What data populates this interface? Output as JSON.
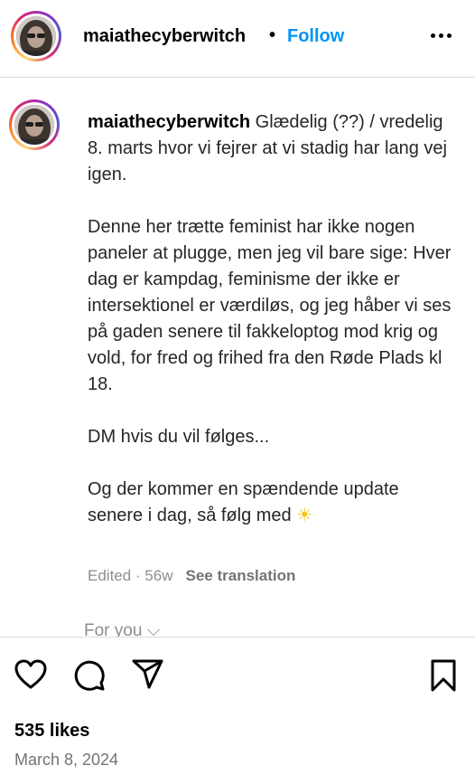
{
  "header": {
    "username": "maiathecyberwitch",
    "separator": "•",
    "follow_label": "Follow",
    "more_icon": "more-horizontal-icon"
  },
  "caption": {
    "username": "maiathecyberwitch",
    "line1": "Glædelig (??) / vredelig 8. marts hvor vi fejrer at vi stadig har lang vej igen.",
    "paragraph2": "Denne her trætte feminist har ikke nogen paneler at plugge, men jeg vil bare sige: Hver dag er kampdag, feminisme der ikke er intersektionel er værdiløs, og jeg håber vi ses på gaden senere til fakkeloptog mod krig og vold, for fred og frihed fra den Røde Plads kl 18.",
    "paragraph3": "DM hvis du vil følges...",
    "paragraph4": "Og der kommer en spændende update senere i dag, så følg med",
    "emoji": "☀",
    "edited": "Edited · 56w",
    "see_translation": "See translation"
  },
  "for_you": "For you ⌵",
  "actions": {
    "like_icon": "heart-icon",
    "comment_icon": "comment-icon",
    "share_icon": "share-icon",
    "save_icon": "bookmark-icon"
  },
  "likes": "535 likes",
  "date": "March 8, 2024"
}
